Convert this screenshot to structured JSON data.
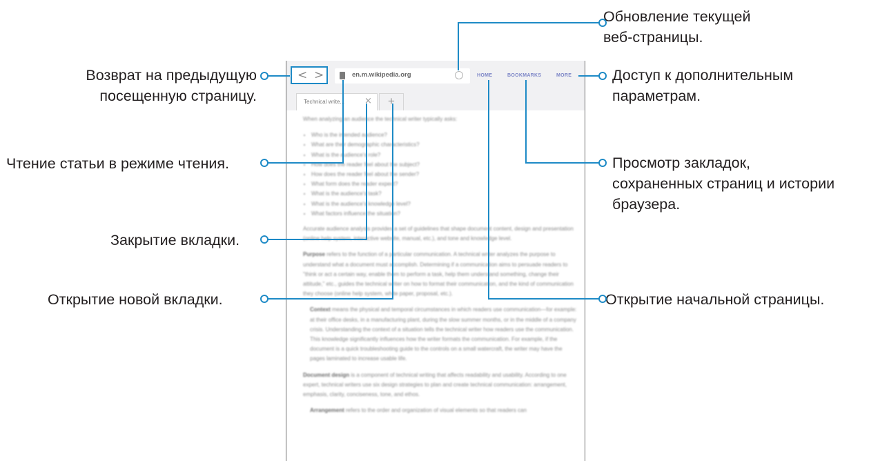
{
  "browser": {
    "back_glyph": "<",
    "forward_glyph": ">",
    "url": "en.m.wikipedia.org",
    "home_label": "HOME",
    "bookmarks_label": "BOOKMARKS",
    "more_label": "MORE",
    "tab_title": "Technical write...",
    "tab_close_glyph": "×",
    "new_tab_glyph": "+"
  },
  "article": {
    "intro": "When analyzing an audience the technical writer typically asks:",
    "questions": [
      "Who is the intended audience?",
      "What are their demographic characteristics?",
      "What is the audience's role?",
      "How does the reader feel about the subject?",
      "How does the reader feel about the sender?",
      "What form does the reader expect?",
      "What is the audience's task?",
      "What is the audience's knowledge level?",
      "What factors influence the situation?"
    ],
    "p1": "Accurate audience analysis provides a set of guidelines that shape document content, design and presentation (online help system, interactive website, manual, etc.), and tone and knowledge level.",
    "p2_bold": "Purpose",
    "p2": " refers to the function of a particular communication. A technical writer analyzes the purpose to understand what a document must accomplish. Determining if a communication aims to persuade readers to \"think or act a certain way, enable them to perform a task, help them understand something, change their attitude,\" etc., guides the technical writer on how to format their communication, and the kind of communication they choose (online help system, white paper, proposal, etc.).",
    "p3_bold": "Context",
    "p3": " means the physical and temporal circumstances in which readers use communication—for example: at their office desks, in a manufacturing plant, during the slow summer months, or in the middle of a company crisis. Understanding the context of a situation tells the technical writer how readers use the communication. This knowledge significantly influences how the writer formats the communication. For example, if the document is a quick troubleshooting guide to the controls on a small watercraft, the writer may have the pages laminated to increase usable life.",
    "p4_bold": "Document design",
    "p4": " is a component of technical writing that affects readability and usability. According to one expert, technical writers use six design strategies to plan and create technical communication: arrangement, emphasis, clarity, conciseness, tone, and ethos.",
    "p5_bold": "Arrangement",
    "p5": " refers to the order and organization of visual elements so that readers can"
  },
  "callouts": {
    "back": [
      "Возврат на предыдущую",
      "посещенную страницу."
    ],
    "reader": "Чтение статьи в режиме чтения.",
    "close_tab": "Закрытие вкладки.",
    "new_tab": "Открытие новой вкладки.",
    "refresh": [
      "Обновление текущей",
      "веб-страницы."
    ],
    "more": [
      "Доступ к дополнительным",
      "параметрам."
    ],
    "bookmarks": [
      "Просмотр закладок,",
      "сохраненных страниц и истории",
      "браузера."
    ],
    "home": "Открытие начальной страницы."
  },
  "colors": {
    "accent": "#1d8ac6",
    "toolbar_link": "#7d86c7"
  }
}
